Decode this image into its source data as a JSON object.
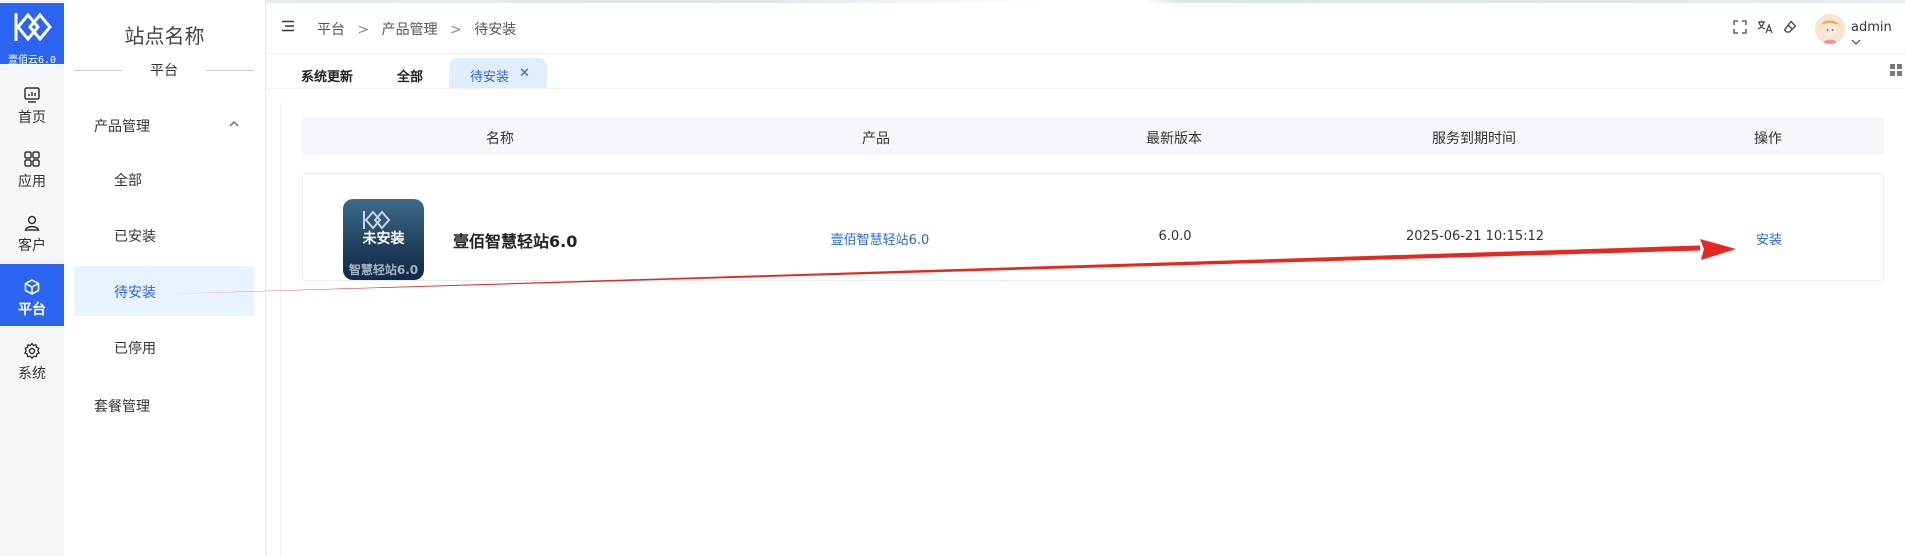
{
  "brand": {
    "logo_text": "壹佰云6.0",
    "accent": "#2a64f0"
  },
  "rail": [
    {
      "label": "首页",
      "icon": "dashboard-icon"
    },
    {
      "label": "应用",
      "icon": "apps-grid-icon"
    },
    {
      "label": "客户",
      "icon": "user-icon"
    },
    {
      "label": "平台",
      "icon": "cube-icon",
      "active": true
    },
    {
      "label": "系统",
      "icon": "gear-icon"
    }
  ],
  "sidebar": {
    "site_name": "站点名称",
    "section": "平台",
    "group": "产品管理",
    "items": [
      {
        "label": "全部"
      },
      {
        "label": "已安装"
      },
      {
        "label": "待安装",
        "active": true
      },
      {
        "label": "已停用"
      }
    ],
    "group2": "套餐管理"
  },
  "header": {
    "breadcrumb": [
      "平台",
      "产品管理",
      "待安装"
    ],
    "separator": ">",
    "user": "admin"
  },
  "tabs": [
    {
      "label": "系统更新"
    },
    {
      "label": "全部"
    },
    {
      "label": "待安装",
      "active": true
    }
  ],
  "table": {
    "columns": [
      "名称",
      "产品",
      "最新版本",
      "服务到期时间",
      "操作"
    ],
    "rows": [
      {
        "image_badge": "未安装",
        "image_caption": "智慧轻站6.0",
        "name": "壹佰智慧轻站6.0",
        "product": "壹佰智慧轻站6.0",
        "version": "6.0.0",
        "expires": "2025-06-21 10:15:12",
        "action": "安装"
      }
    ]
  },
  "annotation": {
    "color": "#e8281e"
  }
}
